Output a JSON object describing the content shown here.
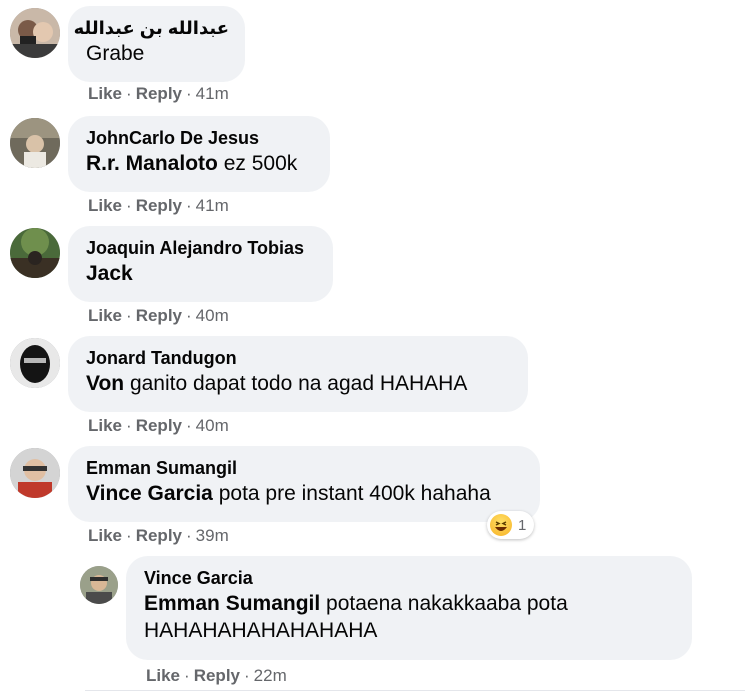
{
  "comments": [
    {
      "author": "عبدالله بن عبدالله",
      "mention": "",
      "text": "Grabe",
      "like": "Like",
      "reply": "Reply",
      "time": "41m"
    },
    {
      "author": "JohnCarlo De Jesus",
      "mention": "R.r. Manaloto",
      "text": " ez 500k",
      "like": "Like",
      "reply": "Reply",
      "time": "41m"
    },
    {
      "author": "Joaquin Alejandro Tobias",
      "mention": "Jack",
      "text": "",
      "like": "Like",
      "reply": "Reply",
      "time": "40m"
    },
    {
      "author": "Jonard Tandugon",
      "mention": "Von",
      "text": " ganito dapat todo na agad HAHAHA",
      "like": "Like",
      "reply": "Reply",
      "time": "40m"
    },
    {
      "author": "Emman Sumangil",
      "mention": "Vince Garcia",
      "text": " pota pre instant 400k hahaha",
      "like": "Like",
      "reply": "Reply",
      "time": "39m",
      "reaction_count": "1",
      "reaction_icon": "haha-emoji-icon"
    }
  ],
  "reply": {
    "author": "Vince Garcia",
    "mention": "Emman Sumangil",
    "text_line1": " potaena nakakkaaba pota",
    "text_line2": "HAHAHAHAHAHAHAHA",
    "like": "Like",
    "reply": "Reply",
    "time": "22m"
  },
  "separator": "·",
  "colors": {
    "bubble": "#f0f2f5",
    "meta": "#65676b",
    "text": "#050505"
  }
}
